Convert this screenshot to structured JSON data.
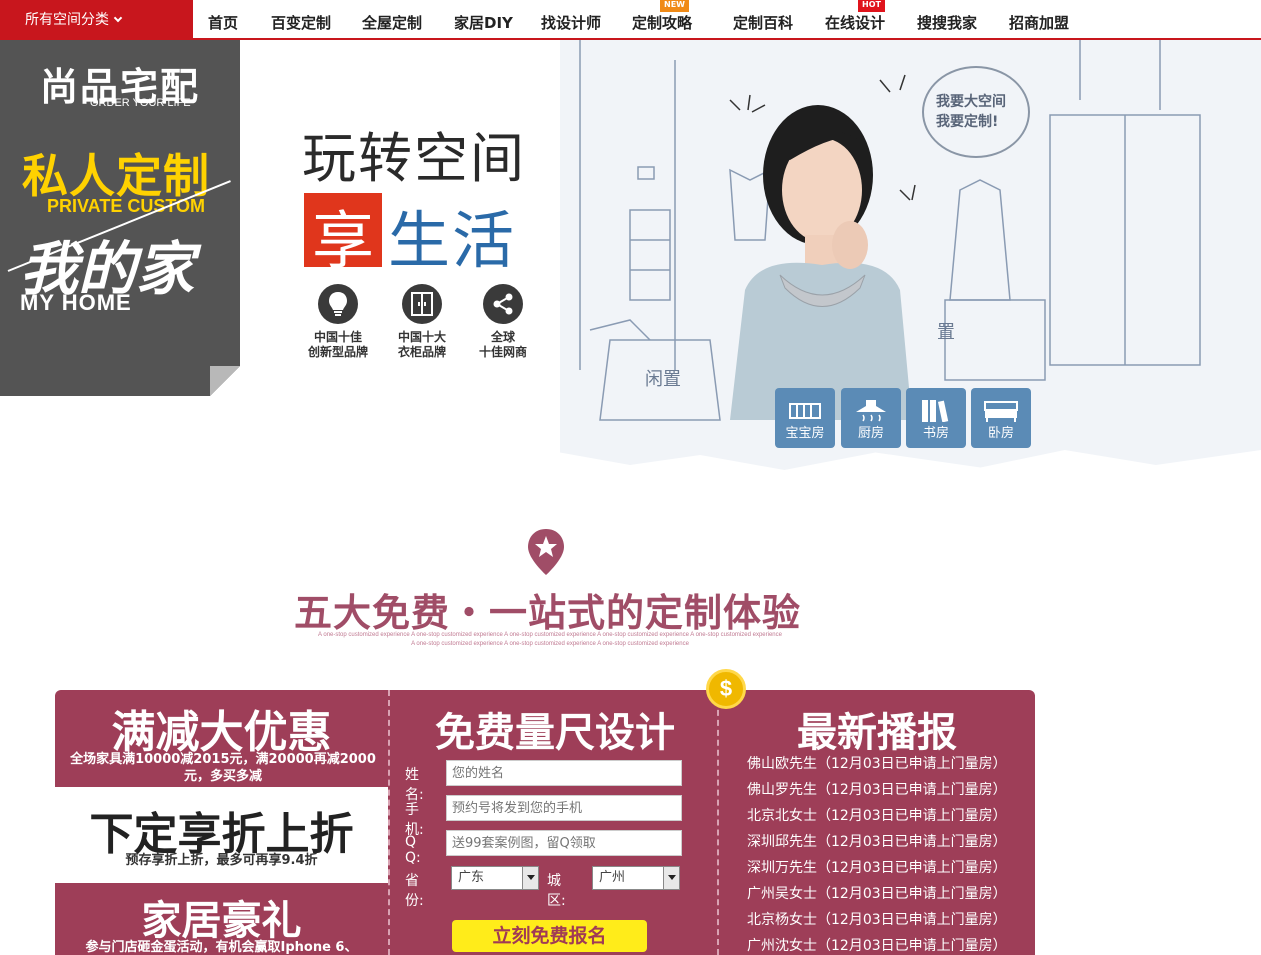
{
  "nav": {
    "category_label": "所有空间分类",
    "items": [
      {
        "label": "首页",
        "badge": ""
      },
      {
        "label": "百变定制",
        "badge": ""
      },
      {
        "label": "全屋定制",
        "badge": ""
      },
      {
        "label": "家居DIY",
        "badge": ""
      },
      {
        "label": "找设计师",
        "badge": ""
      },
      {
        "label": "定制攻略",
        "badge": "NEW"
      },
      {
        "label": "定制百科",
        "badge": ""
      },
      {
        "label": "在线设计",
        "badge": "HOT"
      },
      {
        "label": "搜搜我家",
        "badge": ""
      },
      {
        "label": "招商加盟",
        "badge": ""
      }
    ]
  },
  "hero": {
    "brand_name": "尚品宅配",
    "brand_tagline": "ORDER YOUR LIFE",
    "slogan_cn": "私人定制",
    "slogan_en": "PRIVATE CUSTOM",
    "slogan2_cn": "我的家",
    "slogan2_en": "MY HOME",
    "headline_line1": "玩转空间",
    "headline_line2_a": "享",
    "headline_line2_b": "生活",
    "badges": [
      {
        "icon": "lightbulb-icon",
        "line1": "中国十佳",
        "line2": "创新型品牌"
      },
      {
        "icon": "wardrobe-icon",
        "line1": "中国十大",
        "line2": "衣柜品牌"
      },
      {
        "icon": "share-icon",
        "line1": "全球",
        "line2": "十佳网商"
      }
    ],
    "speech_bubble": [
      "我要大空间",
      "我要定制!"
    ],
    "scene_labels": [
      "闲置",
      "置"
    ],
    "rooms": [
      {
        "label": "宝宝房",
        "icon": "crib-icon"
      },
      {
        "label": "厨房",
        "icon": "range-hood-icon"
      },
      {
        "label": "书房",
        "icon": "books-icon"
      },
      {
        "label": "卧房",
        "icon": "bed-icon"
      }
    ]
  },
  "section": {
    "title": "五大免费・一站式的定制体验",
    "subtitle_line1": "A one-stop customized experience A one-stop customized experience A one-stop customized experience A one-stop customized experience A one-stop customized experience",
    "subtitle_line2": "A one-stop customized experience A one-stop customized experience A one-stop customized experience"
  },
  "promos": {
    "promo1_title": "满减大优惠",
    "promo1_desc": "全场家具满10000减2015元，满20000再减2000元，多买多减",
    "promo2_title": "下定享折上折",
    "promo2_desc": "预存享折上折，最多可再享9.4折",
    "promo3_title": "家居豪礼",
    "promo3_desc": "参与门店砸金蛋活动，有机会赢取Iphone 6、"
  },
  "form": {
    "title": "免费量尺设计",
    "name_label": "姓 名:",
    "name_placeholder": "您的姓名",
    "phone_label": "手 机:",
    "phone_placeholder": "预约号将发到您的手机",
    "qq_label": "Q  Q:",
    "qq_placeholder": "送99套案例图，留Q领取",
    "province_label": "省 份:",
    "province_value": "广东",
    "city_label": "城 区:",
    "city_value": "广州",
    "submit_label": "立刻免费报名"
  },
  "news": {
    "title": "最新播报",
    "items": [
      "佛山欧先生（12月03日已申请上门量房）",
      "佛山罗先生（12月03日已申请上门量房）",
      "北京北女士（12月03日已申请上门量房）",
      "深圳邱先生（12月03日已申请上门量房）",
      "深圳万先生（12月03日已申请上门量房）",
      "广州吴女士（12月03日已申请上门量房）",
      "北京杨女士（12月03日已申请上门量房）",
      "广州沈女士（12月03日已申请上门量房）"
    ]
  },
  "coin_symbol": "$",
  "colors": {
    "brand_red": "#c8161d",
    "board": "#9e3e58",
    "accent_yellow": "#ffd200",
    "headline_blue": "#2a6aa8"
  }
}
